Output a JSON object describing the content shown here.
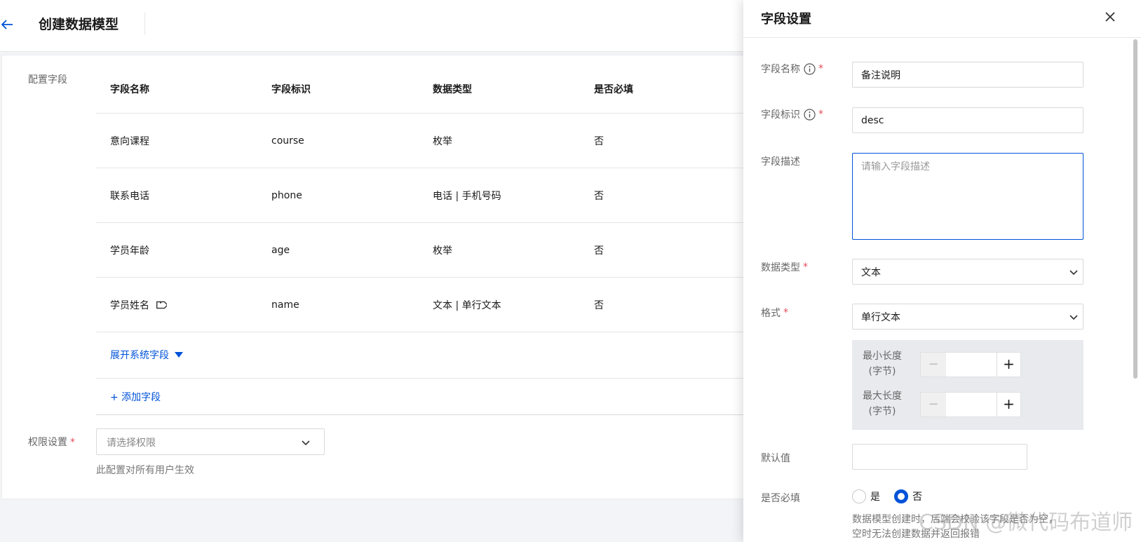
{
  "header": {
    "title": "创建数据模型"
  },
  "fields_section": {
    "label": "配置字段",
    "columns": [
      "字段名称",
      "字段标识",
      "数据类型",
      "是否必填"
    ],
    "rows": [
      {
        "name": "意向课程",
        "key": "course",
        "type": "枚举",
        "required": "否"
      },
      {
        "name": "联系电话",
        "key": "phone",
        "type": "电话 | 手机号码",
        "required": "否"
      },
      {
        "name": "学员年龄",
        "key": "age",
        "type": "枚举",
        "required": "否"
      },
      {
        "name": "学员姓名",
        "key": "name",
        "type": "文本 | 单行文本",
        "required": "否"
      }
    ],
    "expand_label": "展开系统字段",
    "add_label": "+ 添加字段"
  },
  "permission": {
    "label": "权限设置",
    "placeholder": "请选择权限",
    "hint": "此配置对所有用户生效"
  },
  "drawer": {
    "title": "字段设置",
    "field_name": {
      "label": "字段名称",
      "value": "备注说明"
    },
    "field_key": {
      "label": "字段标识",
      "value": "desc"
    },
    "field_desc": {
      "label": "字段描述",
      "placeholder": "请输入字段描述"
    },
    "data_type": {
      "label": "数据类型",
      "value": "文本"
    },
    "format": {
      "label": "格式",
      "value": "单行文本"
    },
    "min_length": {
      "label_line1": "最小长度",
      "label_line2": "(字节)",
      "value": ""
    },
    "max_length": {
      "label_line1": "最大长度",
      "label_line2": "(字节)",
      "value": ""
    },
    "default_value": {
      "label": "默认值",
      "value": ""
    },
    "required": {
      "label": "是否必填",
      "options": [
        "是",
        "否"
      ],
      "selected": "否",
      "hint_line1": "数据模型创建时，后端会校验该字段是否为空，",
      "hint_line2": "空时无法创建数据并返回报错"
    }
  },
  "watermark": "CSDN @微代码布道师",
  "colors": {
    "accent": "#0052d9",
    "required": "#e34d59"
  }
}
